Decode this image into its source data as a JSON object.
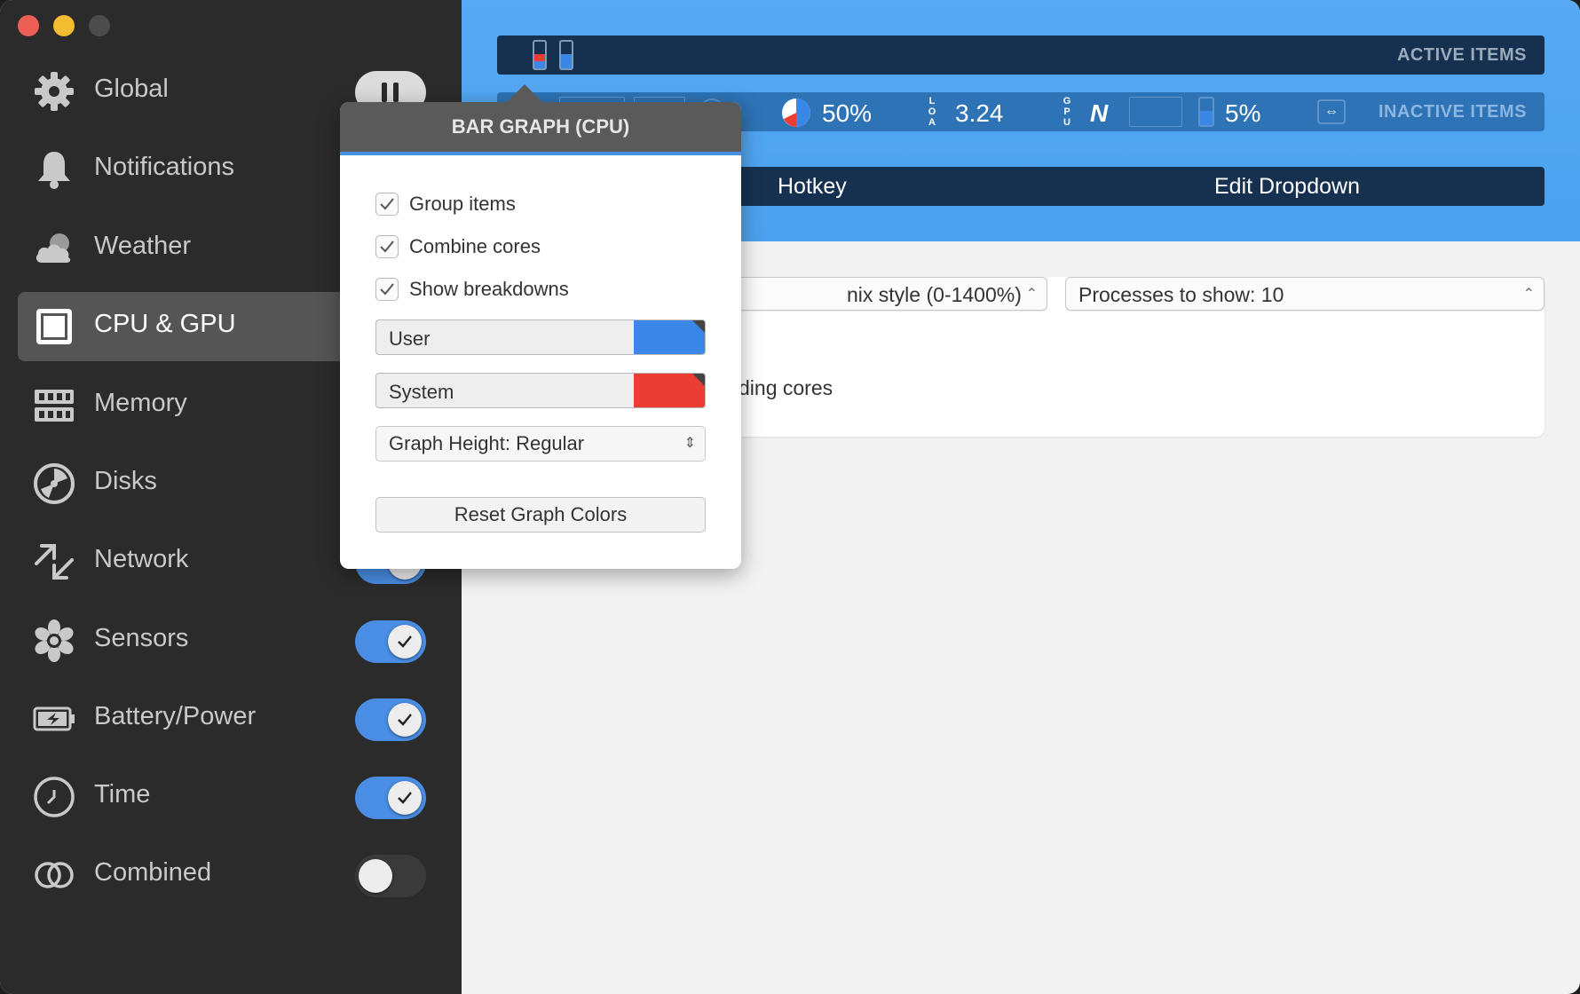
{
  "sidebar": {
    "items": [
      {
        "label": "Global",
        "icon": "gear-icon"
      },
      {
        "label": "Notifications",
        "icon": "bell-icon"
      },
      {
        "label": "Weather",
        "icon": "cloud-icon"
      },
      {
        "label": "CPU & GPU",
        "icon": "cpu-icon"
      },
      {
        "label": "Memory",
        "icon": "memory-icon"
      },
      {
        "label": "Disks",
        "icon": "disk-icon"
      },
      {
        "label": "Network",
        "icon": "network-arrows-icon"
      },
      {
        "label": "Sensors",
        "icon": "fan-icon"
      },
      {
        "label": "Battery/Power",
        "icon": "battery-icon"
      },
      {
        "label": "Time",
        "icon": "clock-icon"
      },
      {
        "label": "Combined",
        "icon": "combined-rings-icon"
      }
    ],
    "selected": "CPU & GPU",
    "toggles": {
      "Sensors": true,
      "Battery/Power": true,
      "Time": true,
      "Combined": false
    }
  },
  "header": {
    "active_label": "ACTIVE ITEMS",
    "inactive_label": "INACTIVE ITEMS",
    "inactive_items": {
      "cpu_percent": "50%",
      "load_value": "3.24",
      "gpu_name": "N",
      "gpu_percent": "5%"
    },
    "buttons": {
      "hotkey": "Hotkey",
      "edit_dropdown": "Edit Dropdown"
    }
  },
  "card": {
    "style_select": "nix style (0-1400%)",
    "processes_select": "Processes to show: 10",
    "cores_text": "ding cores"
  },
  "popover": {
    "title": "BAR GRAPH (CPU)",
    "checkboxes": [
      {
        "label": "Group items",
        "checked": true
      },
      {
        "label": "Combine cores",
        "checked": true
      },
      {
        "label": "Show breakdowns",
        "checked": true
      }
    ],
    "colors": [
      {
        "label": "User",
        "color": "#3b87e8"
      },
      {
        "label": "System",
        "color": "#eb3d33"
      }
    ],
    "graph_height": "Graph Height: Regular",
    "reset_label": "Reset Graph Colors"
  },
  "colors": {
    "accent": "#4a8de4",
    "header_bg": "#4ba1ef",
    "strip_dark": "#16314f",
    "sidebar_bg": "#2b2b2b"
  }
}
